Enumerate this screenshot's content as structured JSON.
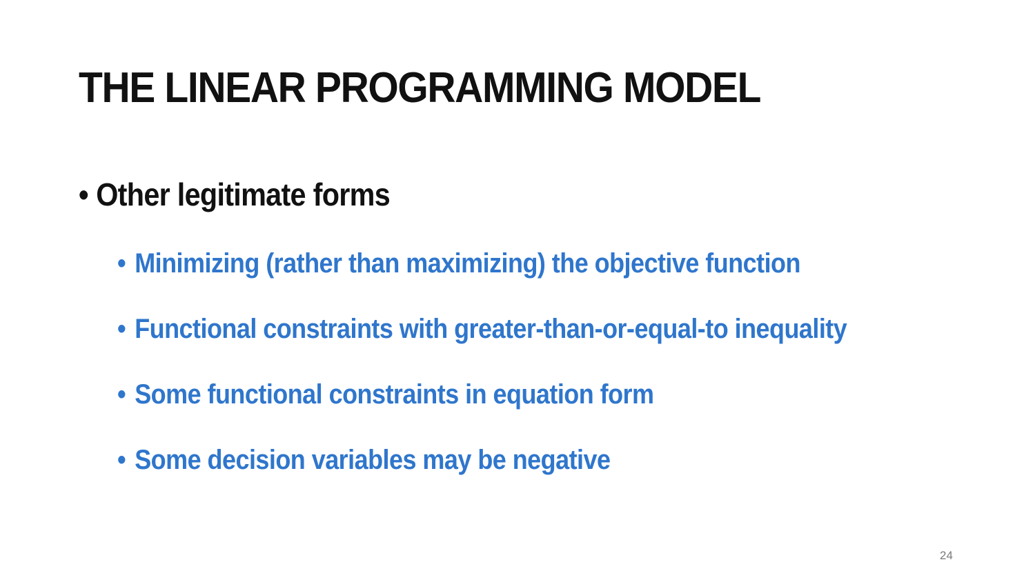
{
  "slide": {
    "title": "THE LINEAR PROGRAMMING MODEL",
    "bullet": "Other legitimate forms",
    "sub_bullets": [
      "Minimizing (rather than maximizing) the objective function",
      "Functional constraints with greater-than-or-equal-to inequality",
      "Some functional constraints in equation form",
      "Some decision variables may be negative"
    ],
    "bullet_glyph": "•",
    "page_number": "24",
    "colors": {
      "title": "#111111",
      "sub_bullet_text": "#2f76cc",
      "page_number": "#7a7a7a"
    }
  }
}
